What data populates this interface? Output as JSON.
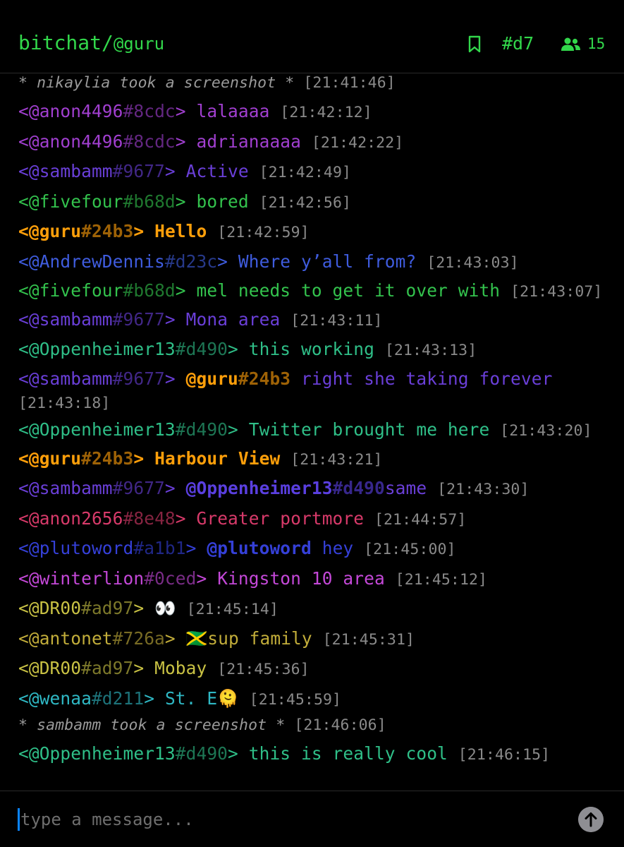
{
  "header": {
    "app_title": "bitchat/",
    "nickname": "@guru",
    "bookmark_icon": "bookmark-icon",
    "channel": "#d7",
    "people_icon": "people-icon",
    "people_count": "15",
    "accent_color": "#32d74b"
  },
  "messages": [
    {
      "type": "system",
      "text": "* nikaylia took a screenshot *",
      "time": "[21:41:46]"
    },
    {
      "type": "chat",
      "sender": "<@anon4496",
      "hash": "#8cdc",
      "close": ">",
      "text": "lalaaaa",
      "time": "[21:42:12]",
      "color": "#a13fd0"
    },
    {
      "type": "chat",
      "sender": "<@anon4496",
      "hash": "#8cdc",
      "close": ">",
      "text": "adrianaaaa",
      "time": "[21:42:22]",
      "color": "#a13fd0"
    },
    {
      "type": "chat",
      "sender": "<@sambamm",
      "hash": "#9677",
      "close": ">",
      "text": "Active",
      "time": "[21:42:49]",
      "color": "#6a3fd8"
    },
    {
      "type": "chat",
      "sender": "<@fivefour",
      "hash": "#b68d",
      "close": ">",
      "text": "bored",
      "time": "[21:42:56]",
      "color": "#33c24d"
    },
    {
      "type": "chat",
      "sender": "<@guru",
      "hash": "#24b3",
      "close": ">",
      "text": "Hello",
      "time": "[21:42:59]",
      "color": "#ff9f0a",
      "bold": true
    },
    {
      "type": "chat",
      "sender": "<@AndrewDennis",
      "hash": "#d23c",
      "close": ">",
      "text": "Where y’all from?",
      "time": "[21:43:03]",
      "color": "#3f5cde"
    },
    {
      "type": "chat",
      "sender": "<@fivefour",
      "hash": "#b68d",
      "close": ">",
      "text": "mel needs to get it over with",
      "time": "[21:43:07]",
      "color": "#33c24d",
      "wrap": true
    },
    {
      "type": "chat",
      "sender": "<@sambamm",
      "hash": "#9677",
      "close": ">",
      "text": "Mona area",
      "time": "[21:43:11]",
      "color": "#6a3fd8"
    },
    {
      "type": "chat",
      "sender": "<@Oppenheimer13",
      "hash": "#d490",
      "close": ">",
      "text": "this working",
      "time": "[21:43:13]",
      "color": "#2fbf88"
    },
    {
      "type": "chat",
      "sender": "<@sambamm",
      "hash": "#9677",
      "close": ">",
      "mention": "@guru",
      "mention_hash": "#24b3",
      "mention_color": "#ff9f0a",
      "text": "right she taking forever",
      "time": "[21:43:18]",
      "color": "#6a3fd8",
      "wrap": true
    },
    {
      "type": "chat",
      "sender": "<@Oppenheimer13",
      "hash": "#d490",
      "close": ">",
      "text": "Twitter brought me here",
      "time": "[21:43:20]",
      "color": "#2fbf88",
      "wrap": true
    },
    {
      "type": "chat",
      "sender": "<@guru",
      "hash": "#24b3",
      "close": ">",
      "text": "Harbour View",
      "time": "[21:43:21]",
      "color": "#ff9f0a",
      "bold": true
    },
    {
      "type": "chat",
      "sender": "<@sambamm",
      "hash": "#9677",
      "close": ">",
      "mention": "@Oppenheimer13",
      "mention_hash": "#d490",
      "mention_color": "#5a3fe0",
      "text": "same",
      "time": "[21:43:30]",
      "color": "#6a3fd8",
      "nospace": true
    },
    {
      "type": "chat",
      "sender": "<@anon2656",
      "hash": "#8e48",
      "close": ">",
      "text": "Greater portmore",
      "time": "[21:44:57]",
      "color": "#d83a6a"
    },
    {
      "type": "chat",
      "sender": "<@plutoword",
      "hash": "#a1b1",
      "close": ">",
      "mention": "@plutoword",
      "mention_hash": "",
      "mention_color": "#3540d8",
      "text": "hey",
      "time": "[21:45:00]",
      "color": "#3540d8"
    },
    {
      "type": "chat",
      "sender": "<@winterlion",
      "hash": "#0ced",
      "close": ">",
      "text": "Kingston 10 area",
      "time": "[21:45:12]",
      "color": "#c448d8"
    },
    {
      "type": "chat",
      "sender": "<@DR00",
      "hash": "#ad97",
      "close": ">",
      "text": "👀",
      "time": "[21:45:14]",
      "color": "#c9c244"
    },
    {
      "type": "chat",
      "sender": "<@antonet",
      "hash": "#726a",
      "close": ">",
      "text": "🇯🇲sup family",
      "time": "[21:45:31]",
      "color": "#c2ad3a"
    },
    {
      "type": "chat",
      "sender": "<@DR00",
      "hash": "#ad97",
      "close": ">",
      "text": "Mobay",
      "time": "[21:45:36]",
      "color": "#c9c244"
    },
    {
      "type": "chat",
      "sender": "<@wenaa",
      "hash": "#d211",
      "close": ">",
      "text": "St. E🫠",
      "time": "[21:45:59]",
      "color": "#2fb8c4"
    },
    {
      "type": "system",
      "text": "* sambamm took a screenshot *",
      "time": "[21:46:06]"
    },
    {
      "type": "chat",
      "sender": "<@Oppenheimer13",
      "hash": "#d490",
      "close": ">",
      "text": "this is really cool",
      "time": "[21:46:15]",
      "color": "#2fbf88"
    }
  ],
  "input": {
    "placeholder": "type a message...",
    "value": "",
    "send_icon": "arrow-up-icon"
  }
}
